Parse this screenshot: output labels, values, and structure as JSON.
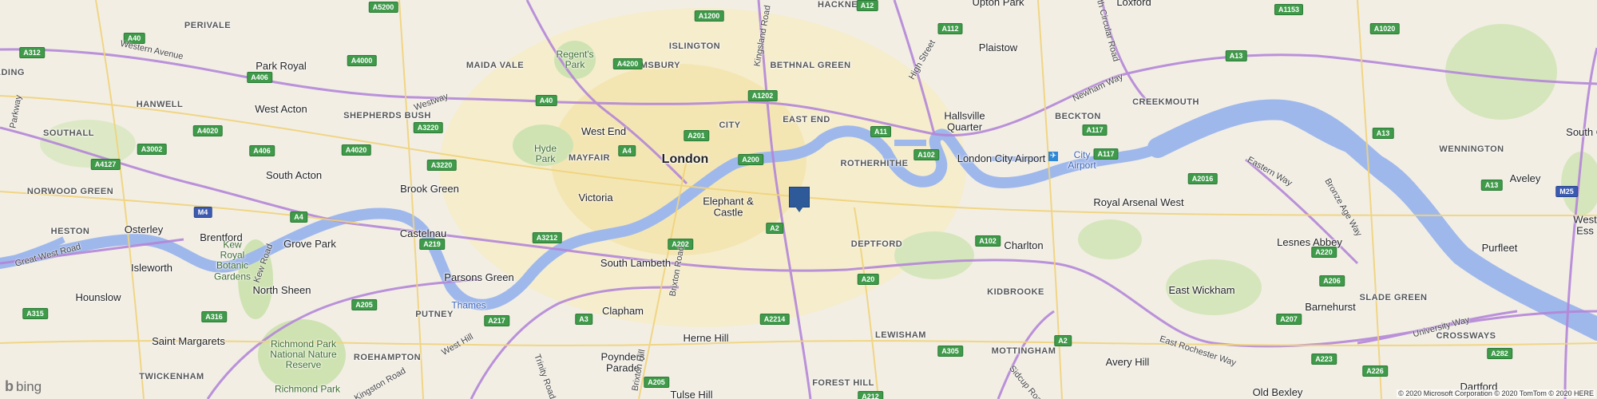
{
  "map": {
    "provider_logo": "bing",
    "copyright": "© 2020 Microsoft Corporation © 2020 TomTom © 2020 HERE",
    "marker": {
      "name": "location-marker"
    }
  },
  "places": [
    {
      "id": "upton-park",
      "text": "Upton Park",
      "cls": "md"
    },
    {
      "id": "loxford",
      "text": "Loxford",
      "cls": "md"
    },
    {
      "id": "hackney",
      "text": "HACKNEY",
      "cls": "district"
    },
    {
      "id": "perivale",
      "text": "PERIVALE",
      "cls": "district"
    },
    {
      "id": "islington",
      "text": "ISLINGTON",
      "cls": "district"
    },
    {
      "id": "regents-park",
      "text": "Regent's\nPark",
      "cls": "park"
    },
    {
      "id": "plaistow",
      "text": "Plaistow",
      "cls": "md"
    },
    {
      "id": "park-royal",
      "text": "Park Royal",
      "cls": "md"
    },
    {
      "id": "maida-vale",
      "text": "MAIDA VALE",
      "cls": "district"
    },
    {
      "id": "bloomsbury",
      "text": "BLOOMSBURY",
      "cls": "district"
    },
    {
      "id": "bethnal-green",
      "text": "BETHNAL GREEN",
      "cls": "district"
    },
    {
      "id": "ading",
      "text": "ADING",
      "cls": "district"
    },
    {
      "id": "hanwell",
      "text": "HANWELL",
      "cls": "district"
    },
    {
      "id": "west-acton",
      "text": "West Acton",
      "cls": "md"
    },
    {
      "id": "shepherds-bush",
      "text": "SHEPHERDS BUSH",
      "cls": "district"
    },
    {
      "id": "creekmouth",
      "text": "CREEKMOUTH",
      "cls": "district"
    },
    {
      "id": "hallsville-quarter",
      "text": "Hallsville\nQuarter",
      "cls": "md"
    },
    {
      "id": "beckton",
      "text": "BECKTON",
      "cls": "district"
    },
    {
      "id": "east-end",
      "text": "EAST END",
      "cls": "district"
    },
    {
      "id": "city",
      "text": "CITY",
      "cls": "district"
    },
    {
      "id": "west-end",
      "text": "West End",
      "cls": "md"
    },
    {
      "id": "southall",
      "text": "SOUTHALL",
      "cls": "district"
    },
    {
      "id": "hyde-park",
      "text": "Hyde\nPark",
      "cls": "park"
    },
    {
      "id": "mayfair",
      "text": "MAYFAIR",
      "cls": "district"
    },
    {
      "id": "london",
      "text": "London",
      "cls": "lg"
    },
    {
      "id": "wennington",
      "text": "WENNINGTON",
      "cls": "district"
    },
    {
      "id": "south-o",
      "text": "South O",
      "cls": "md"
    },
    {
      "id": "london-city-airport",
      "text": "London City Airport",
      "cls": "md"
    },
    {
      "id": "city-airport",
      "text": "City\nAirport",
      "cls": "water"
    },
    {
      "id": "rotherhithe",
      "text": "ROTHERHITHE",
      "cls": "district"
    },
    {
      "id": "south-acton",
      "text": "South Acton",
      "cls": "md"
    },
    {
      "id": "norwood-green",
      "text": "NORWOOD GREEN",
      "cls": "district"
    },
    {
      "id": "brook-green",
      "text": "Brook Green",
      "cls": "md"
    },
    {
      "id": "victoria",
      "text": "Victoria",
      "cls": "md"
    },
    {
      "id": "elephant-castle",
      "text": "Elephant &\nCastle",
      "cls": "md"
    },
    {
      "id": "royal-arsenal-west",
      "text": "Royal Arsenal West",
      "cls": "md"
    },
    {
      "id": "aveley",
      "text": "Aveley",
      "cls": "md"
    },
    {
      "id": "osterley",
      "text": "Osterley",
      "cls": "md"
    },
    {
      "id": "heston",
      "text": "HESTON",
      "cls": "district"
    },
    {
      "id": "brentford",
      "text": "Brentford",
      "cls": "md"
    },
    {
      "id": "castelnau",
      "text": "Castelnau",
      "cls": "md"
    },
    {
      "id": "grove-park",
      "text": "Grove Park",
      "cls": "md"
    },
    {
      "id": "deptford",
      "text": "DEPTFORD",
      "cls": "district"
    },
    {
      "id": "charlton",
      "text": "Charlton",
      "cls": "md"
    },
    {
      "id": "lesnes-abbey",
      "text": "Lesnes Abbey",
      "cls": "md"
    },
    {
      "id": "purfleet",
      "text": "Purfleet",
      "cls": "md"
    },
    {
      "id": "kew-gardens",
      "text": "Kew\nRoyal\nBotanic\nGardens",
      "cls": "park"
    },
    {
      "id": "isleworth",
      "text": "Isleworth",
      "cls": "md"
    },
    {
      "id": "south-lambeth",
      "text": "South Lambeth",
      "cls": "md"
    },
    {
      "id": "parsons-green",
      "text": "Parsons Green",
      "cls": "md"
    },
    {
      "id": "north-sheen",
      "text": "North Sheen",
      "cls": "md"
    },
    {
      "id": "hounslow",
      "text": "Hounslow",
      "cls": "md"
    },
    {
      "id": "kidbrooke",
      "text": "KIDBROOKE",
      "cls": "district"
    },
    {
      "id": "east-wickham",
      "text": "East Wickham",
      "cls": "md"
    },
    {
      "id": "thames",
      "text": "Thames",
      "cls": "water"
    },
    {
      "id": "putney",
      "text": "PUTNEY",
      "cls": "district"
    },
    {
      "id": "clapham",
      "text": "Clapham",
      "cls": "md"
    },
    {
      "id": "barnehurst",
      "text": "Barnehurst",
      "cls": "md"
    },
    {
      "id": "slade-green",
      "text": "SLADE GREEN",
      "cls": "district"
    },
    {
      "id": "lewisham",
      "text": "LEWISHAM",
      "cls": "district"
    },
    {
      "id": "herne-hill",
      "text": "Herne Hill",
      "cls": "md"
    },
    {
      "id": "saint-margarets",
      "text": "Saint Margarets",
      "cls": "md"
    },
    {
      "id": "richmond-park-nnr",
      "text": "Richmond Park\nNational Nature\nReserve",
      "cls": "park"
    },
    {
      "id": "roehampton",
      "text": "ROEHAMPTON",
      "cls": "district"
    },
    {
      "id": "mottingham",
      "text": "MOTTINGHAM",
      "cls": "district"
    },
    {
      "id": "crossways",
      "text": "CROSSWAYS",
      "cls": "district"
    },
    {
      "id": "poynders-parade",
      "text": "Poynders\nParade",
      "cls": "md"
    },
    {
      "id": "avery-hill",
      "text": "Avery Hill",
      "cls": "md"
    },
    {
      "id": "forest-hill",
      "text": "FOREST HILL",
      "cls": "district"
    },
    {
      "id": "twickenham",
      "text": "TWICKENHAM",
      "cls": "district"
    },
    {
      "id": "richmond-park",
      "text": "Richmond Park",
      "cls": "park"
    },
    {
      "id": "tulse-hill",
      "text": "Tulse Hill",
      "cls": "md"
    },
    {
      "id": "dartford",
      "text": "Dartford",
      "cls": "md"
    },
    {
      "id": "old-bexley",
      "text": "Old Bexley",
      "cls": "md"
    },
    {
      "id": "west-ess",
      "text": "West\nEss",
      "cls": "md"
    }
  ],
  "shields": [
    {
      "id": "a312",
      "text": "A312"
    },
    {
      "id": "a40-w",
      "text": "A40"
    },
    {
      "id": "a406-n",
      "text": "A406"
    },
    {
      "id": "a4000",
      "text": "A4000"
    },
    {
      "id": "a5200",
      "text": "A5200"
    },
    {
      "id": "a4200",
      "text": "A4200"
    },
    {
      "id": "a1200",
      "text": "A1200"
    },
    {
      "id": "a12-n",
      "text": "A12"
    },
    {
      "id": "a112",
      "text": "A112"
    },
    {
      "id": "a1020",
      "text": "A1020"
    },
    {
      "id": "a1153",
      "text": "A1153"
    },
    {
      "id": "a40-c",
      "text": "A40"
    },
    {
      "id": "a1202",
      "text": "A1202"
    },
    {
      "id": "a13-e",
      "text": "A13"
    },
    {
      "id": "a3220-n",
      "text": "A3220"
    },
    {
      "id": "a4020-w",
      "text": "A4020"
    },
    {
      "id": "a201",
      "text": "A201"
    },
    {
      "id": "a11",
      "text": "A11"
    },
    {
      "id": "a117",
      "text": "A117"
    },
    {
      "id": "a13-far",
      "text": "A13"
    },
    {
      "id": "a3002",
      "text": "A3002"
    },
    {
      "id": "a406-s",
      "text": "A406"
    },
    {
      "id": "a4020-c",
      "text": "A4020"
    },
    {
      "id": "a4",
      "text": "A4"
    },
    {
      "id": "a200",
      "text": "A200"
    },
    {
      "id": "a102-n",
      "text": "A102"
    },
    {
      "id": "a117-s",
      "text": "A117"
    },
    {
      "id": "a4127",
      "text": "A4127"
    },
    {
      "id": "a3220-s",
      "text": "A3220"
    },
    {
      "id": "a2016",
      "text": "A2016"
    },
    {
      "id": "a13-wenn",
      "text": "A13"
    },
    {
      "id": "m4",
      "text": "M4",
      "motorway": true
    },
    {
      "id": "a4-w",
      "text": "A4"
    },
    {
      "id": "a2",
      "text": "A2"
    },
    {
      "id": "m25",
      "text": "M25",
      "motorway": true
    },
    {
      "id": "a219",
      "text": "A219"
    },
    {
      "id": "a3212",
      "text": "A3212"
    },
    {
      "id": "a202",
      "text": "A202"
    },
    {
      "id": "a102-s",
      "text": "A102"
    },
    {
      "id": "a220",
      "text": "A220"
    },
    {
      "id": "a20",
      "text": "A20"
    },
    {
      "id": "a206",
      "text": "A206"
    },
    {
      "id": "a205-w",
      "text": "A205"
    },
    {
      "id": "a315",
      "text": "A315"
    },
    {
      "id": "a316",
      "text": "A316"
    },
    {
      "id": "a217",
      "text": "A217"
    },
    {
      "id": "a3",
      "text": "A3"
    },
    {
      "id": "a207",
      "text": "A207"
    },
    {
      "id": "a2214",
      "text": "A2214"
    },
    {
      "id": "a2-s",
      "text": "A2"
    },
    {
      "id": "a305",
      "text": "A305"
    },
    {
      "id": "a223",
      "text": "A223"
    },
    {
      "id": "a282",
      "text": "A282"
    },
    {
      "id": "a205-s",
      "text": "A205"
    },
    {
      "id": "a226",
      "text": "A226"
    },
    {
      "id": "a212",
      "text": "A212"
    }
  ],
  "roads": [
    {
      "id": "western-avenue",
      "text": "Western Avenue"
    },
    {
      "id": "westway",
      "text": "Westway"
    },
    {
      "id": "kingsland-road",
      "text": "Kingsland Road"
    },
    {
      "id": "high-street",
      "text": "High Street"
    },
    {
      "id": "north-circular",
      "text": "North Circular Road"
    },
    {
      "id": "newham-way",
      "text": "Newham Way"
    },
    {
      "id": "eastern-way",
      "text": "Eastern Way"
    },
    {
      "id": "bronze-age-way",
      "text": "Bronze Age Way"
    },
    {
      "id": "great-west-road",
      "text": "Great West Road"
    },
    {
      "id": "kew-road",
      "text": "Kew Road"
    },
    {
      "id": "brixton-road",
      "text": "Brixton Road"
    },
    {
      "id": "university-way",
      "text": "University Way"
    },
    {
      "id": "east-rochester-way",
      "text": "East Rochester Way"
    },
    {
      "id": "west-hill",
      "text": "West Hill"
    },
    {
      "id": "kingston-road",
      "text": "Kingston Road"
    },
    {
      "id": "trinity-road",
      "text": "Trinity Road"
    },
    {
      "id": "brixton-hill",
      "text": "Brixton Hill"
    },
    {
      "id": "sidcup-road",
      "text": "Sidcup Road"
    },
    {
      "id": "parkway",
      "text": "Parkway"
    }
  ]
}
